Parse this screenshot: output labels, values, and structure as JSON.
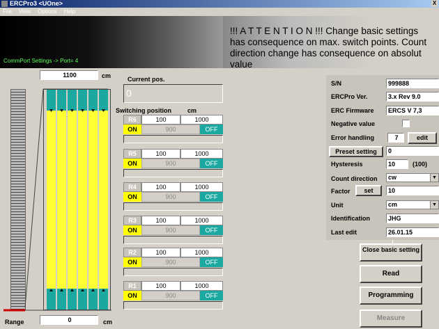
{
  "window": {
    "title": "ERCPro3 <UOne>",
    "close_glyph": "X"
  },
  "menu": [
    "File",
    "View",
    "Options",
    "Help"
  ],
  "header": {
    "comport": "CommPort Settings -> Port= 4",
    "attention": "!!! A T T E N T I O N !!!  Change basic settings has consequence on max. switch points. Count direction change has consequence on absolut value"
  },
  "gauge": {
    "top_value": "1100",
    "top_unit": "cm",
    "range_label": "Range",
    "range_value": "0",
    "range_unit": "cm"
  },
  "current": {
    "label": "Current pos.",
    "value": "0"
  },
  "switching": {
    "header": "Switching position",
    "unit": "cm",
    "rows": [
      {
        "id": "R6",
        "low": "100",
        "high": "1000",
        "on": "ON",
        "mid": "900",
        "off": "OFF"
      },
      {
        "id": "R5",
        "low": "100",
        "high": "1000",
        "on": "ON",
        "mid": "900",
        "off": "OFF"
      },
      {
        "id": "R4",
        "low": "100",
        "high": "1000",
        "on": "ON",
        "mid": "900",
        "off": "OFF"
      },
      {
        "id": "R3",
        "low": "100",
        "high": "1000",
        "on": "ON",
        "mid": "900",
        "off": "OFF"
      },
      {
        "id": "R2",
        "low": "100",
        "high": "1000",
        "on": "ON",
        "mid": "900",
        "off": "OFF"
      },
      {
        "id": "R1",
        "low": "100",
        "high": "1000",
        "on": "ON",
        "mid": "900",
        "off": "OFF"
      }
    ]
  },
  "settings": {
    "sn_label": "S/N",
    "sn_value": "999888",
    "ver_label": "ERCPro Ver.",
    "ver_value": "3.x Rev 9.0",
    "fw_label": "ERC Firmware",
    "fw_value": "ERCS V 7,3",
    "neg_label": "Negative value",
    "err_label": "Error handling",
    "err_value": "7",
    "err_button": "edit",
    "preset_button": "Preset setting",
    "preset_value": "0",
    "hyst_label": "Hysteresis",
    "hyst_value": "10",
    "hyst_hint": "(100)",
    "count_label": "Count direction",
    "count_value": "cw",
    "factor_label": "Factor",
    "factor_button": "set",
    "factor_value": "10",
    "unit_label": "Unit",
    "unit_value": "cm",
    "ident_label": "Identification",
    "ident_value": "JHG",
    "edit_label": "Last edit",
    "edit_value": "26.01.15"
  },
  "buttons": {
    "close": "Close basic setting",
    "read": "Read",
    "programming": "Programming",
    "measure": "Measure"
  },
  "colors": {
    "yellow": "#ffff33",
    "teal": "#1aa8a0",
    "red_marker": "#cc0000"
  }
}
